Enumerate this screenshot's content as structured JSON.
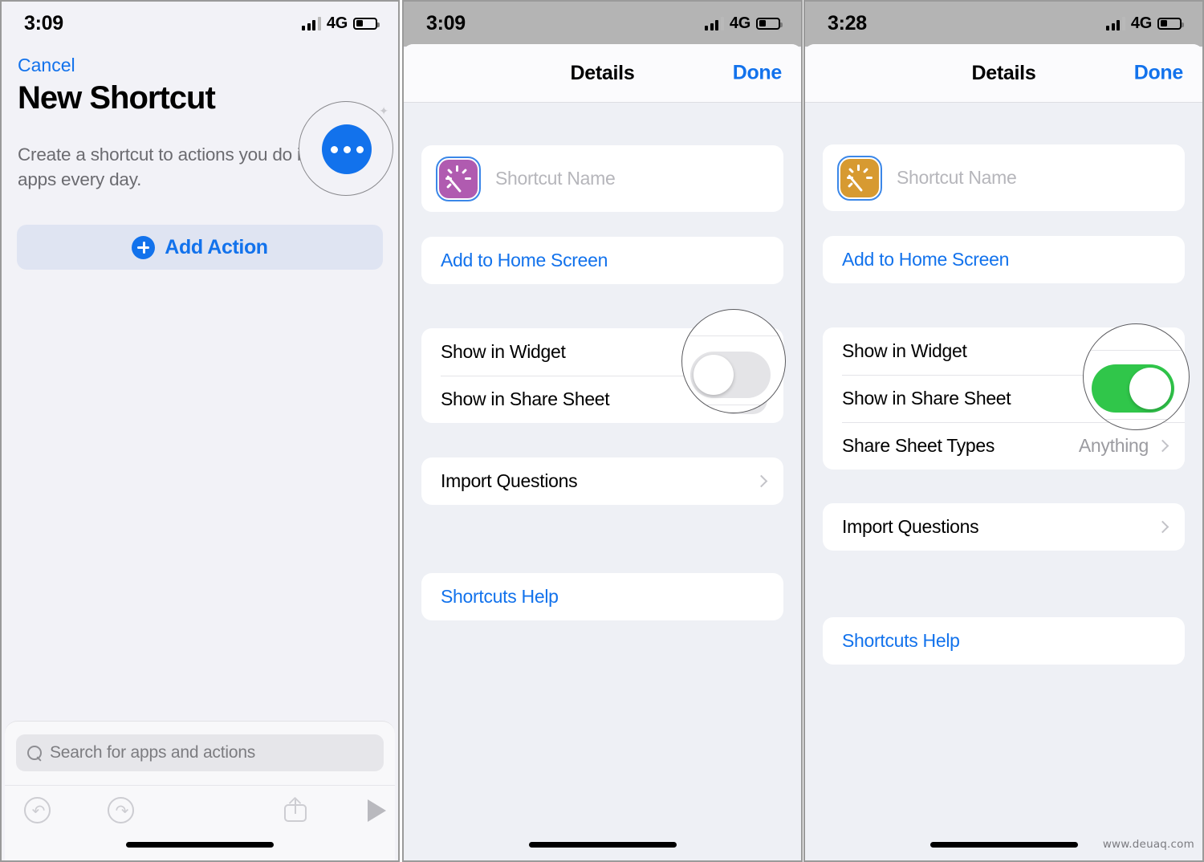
{
  "watermark": "www.deuaq.com",
  "panel1": {
    "status": {
      "time": "3:09",
      "network": "4G",
      "battery_icon": "battery-icon",
      "signal_icon": "signal-bars-icon"
    },
    "cancel_label": "Cancel",
    "title": "New Shortcut",
    "subtitle": "Create a shortcut to actions you do in your apps every day.",
    "menu_button_icon": "ellipsis-icon",
    "add_action_label": "Add Action",
    "add_action_icon": "plus-circle-icon",
    "search": {
      "placeholder": "Search for apps and actions",
      "icon": "search-icon"
    },
    "toolbar": {
      "undo_icon": "undo-icon",
      "redo_icon": "redo-icon",
      "share_icon": "share-icon",
      "play_icon": "play-icon"
    }
  },
  "panel2": {
    "status": {
      "time": "3:09",
      "network": "4G"
    },
    "nav": {
      "title": "Details",
      "done_label": "Done"
    },
    "name_field": {
      "placeholder": "Shortcut Name",
      "icon": "magic-wand-icon",
      "icon_color": "#b05bb0"
    },
    "add_home_label": "Add to Home Screen",
    "rows": [
      {
        "label": "Show in Widget",
        "toggle": "on"
      },
      {
        "label": "Show in Share Sheet",
        "toggle": "off"
      }
    ],
    "import_questions_label": "Import Questions",
    "help_label": "Shortcuts Help",
    "magnifier": {
      "toggle_state": "off",
      "target": "Show in Share Sheet"
    }
  },
  "panel3": {
    "status": {
      "time": "3:28",
      "network": "4G"
    },
    "nav": {
      "title": "Details",
      "done_label": "Done"
    },
    "name_field": {
      "placeholder": "Shortcut Name",
      "icon": "magic-wand-icon",
      "icon_color": "#d79a31"
    },
    "add_home_label": "Add to Home Screen",
    "rows": [
      {
        "label": "Show in Widget",
        "toggle": "on"
      },
      {
        "label": "Show in Share Sheet",
        "toggle": "on"
      },
      {
        "label": "Share Sheet Types",
        "value": "Anything"
      }
    ],
    "import_questions_label": "Import Questions",
    "help_label": "Shortcuts Help",
    "magnifier": {
      "toggle_state": "on",
      "target": "Show in Share Sheet",
      "value_text": "Anything"
    }
  },
  "colors": {
    "accent_blue": "#1272ec",
    "toggle_green": "#30c64a",
    "sheet_bg": "#eef0f5",
    "card_bg": "#ffffff",
    "muted_text": "#9b9ba0"
  }
}
